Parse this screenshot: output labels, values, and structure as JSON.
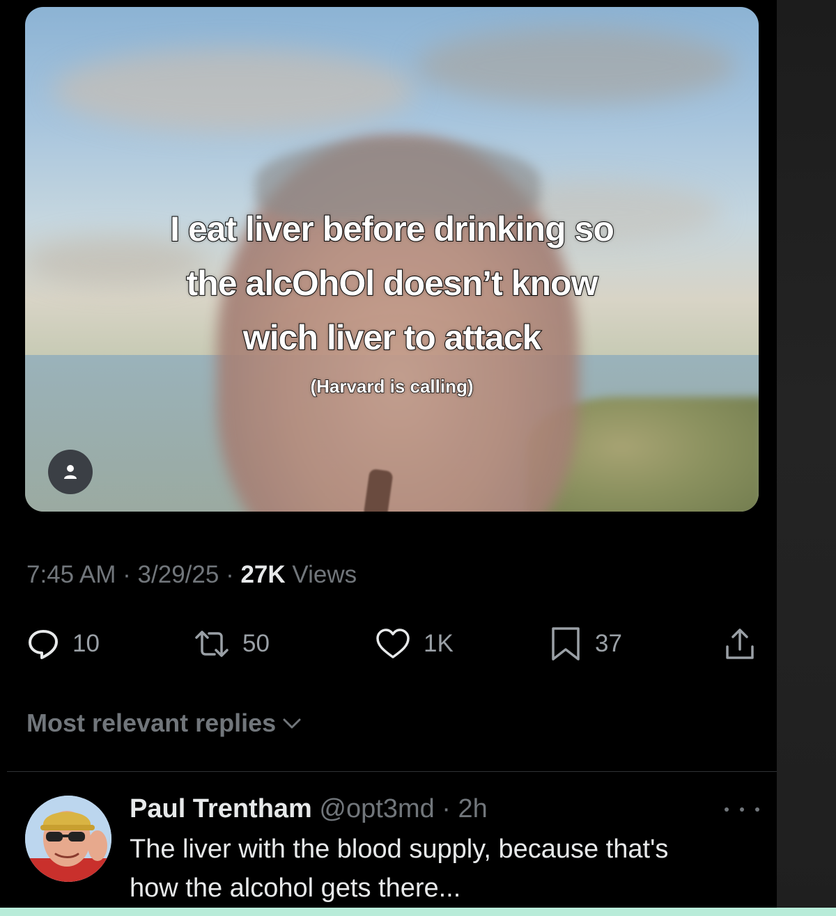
{
  "post": {
    "media": {
      "caption_lines": [
        "I eat liver before drinking so",
        "the alcOhOl doesn’t know",
        "wich liver to attack"
      ],
      "caption_sub": "(Harvard is calling)"
    },
    "meta": {
      "time": "7:45 AM",
      "separator": "·",
      "date": "3/29/25",
      "views_count": "27K",
      "views_label": "Views"
    },
    "actions": {
      "replies": "10",
      "reposts": "50",
      "likes": "1K",
      "bookmarks": "37"
    }
  },
  "replies_filter": {
    "label": "Most relevant replies"
  },
  "reply": {
    "name": "Paul Trentham",
    "handle": "@opt3md",
    "separator": "·",
    "time": "2h",
    "text_line1": "The liver with the blood supply, because that's",
    "text_line2": "how the alcohol gets there..."
  },
  "icons": {
    "reply": "speech-bubble-icon",
    "repost": "repost-arrows-icon",
    "like": "heart-icon",
    "bookmark": "bookmark-icon",
    "share": "share-upload-icon",
    "profile": "person-icon",
    "more": "more-dots-icon",
    "filter": "chevron-down-icon"
  },
  "colors": {
    "background": "#000000",
    "text_primary": "#e7e9ea",
    "text_secondary": "#71767b",
    "icon": "#9aa0a6"
  }
}
